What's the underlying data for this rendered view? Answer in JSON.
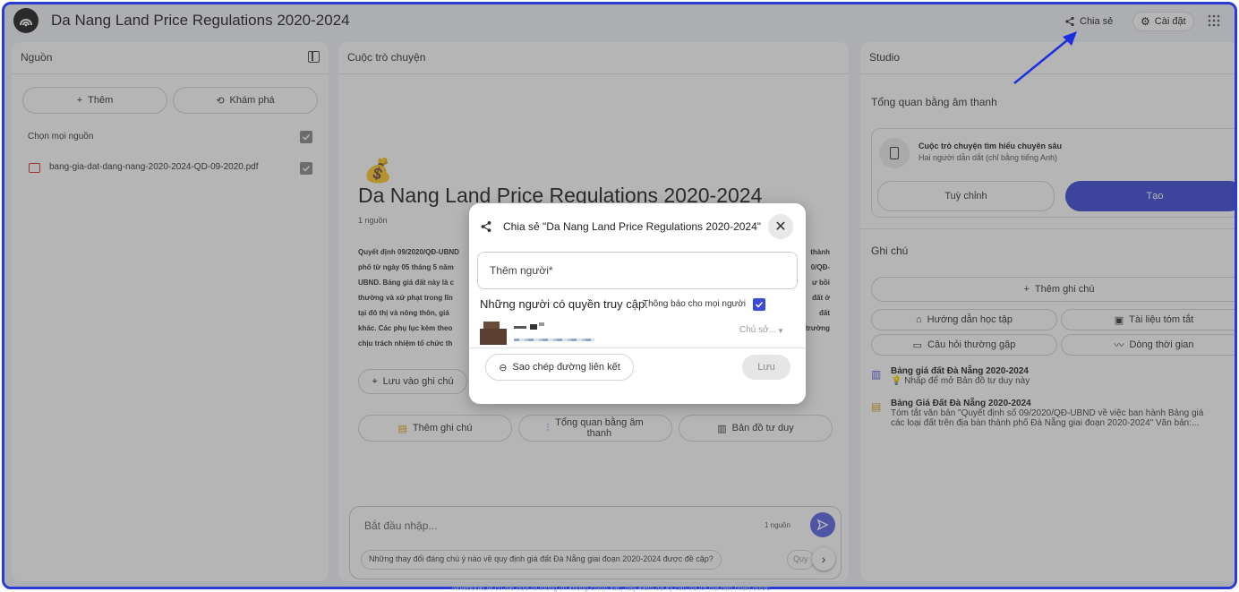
{
  "app": {
    "title": "Da Nang Land Price Regulations 2020-2024"
  },
  "topbar": {
    "share_label": "Chia sẻ",
    "settings_label": "Cài đặt"
  },
  "sources": {
    "header": "Nguồn",
    "add_label": "Thêm",
    "explore_label": "Khám phá",
    "select_all_label": "Chọn mọi nguồn",
    "files": [
      "bang-gia-dat-dang-nang-2020-2024-QD-09-2020.pdf"
    ]
  },
  "chat": {
    "header": "Cuộc trò chuyện",
    "emoji": "💰",
    "notebook_title": "Da Nang Land Price Regulations 2020-2024",
    "source_count": "1 nguồn",
    "summary_lines": [
      "Quyết định 09/2020/QĐ-UBND",
      "phố từ ngày 05 tháng 5 năm",
      "UBND. Bảng giá đất này là c",
      "thường và xử phạt trong lĩn",
      "tại đô thị và nông thôn, giá",
      "khác. Các phụ lục kèm theo",
      "chịu trách nhiệm tổ chức th"
    ],
    "summary_right": [
      "thành",
      "0/QĐ-",
      "ư bồi",
      "đất ở",
      "đất",
      "trường",
      ""
    ],
    "save_note_label": "Lưu vào ghi chú",
    "action_add_note": "Thêm ghi chú",
    "action_audio": "Tổng quan bằng âm thanh",
    "action_mindmap": "Bản đồ tư duy",
    "input_placeholder": "Bắt đầu nhập...",
    "input_source_count": "1 nguồn",
    "suggestion": "Những thay đổi đáng chú ý nào về quy định giá đất Đà Nẵng giai đoạn 2020-2024 được đề cập?",
    "suggestion_next": "Quy"
  },
  "studio": {
    "header": "Studio",
    "audio_overview_label": "Tổng quan bằng âm thanh",
    "deep_dive_title": "Cuộc trò chuyện tìm hiểu chuyên sâu",
    "deep_dive_sub": "Hai người dẫn dắt (chỉ bằng tiếng Anh)",
    "customize_label": "Tuỳ chỉnh",
    "generate_label": "Tạo",
    "notes_header": "Ghi chú",
    "add_note_label": "Thêm ghi chú",
    "study_guide_label": "Hướng dẫn học tập",
    "briefing_label": "Tài liệu tóm tắt",
    "faq_label": "Câu hỏi thường gặp",
    "timeline_label": "Dòng thời gian",
    "notes": [
      {
        "title": "Bảng giá đất Đà Nẵng 2020-2024",
        "body": "Nhấp để mở Bản đồ tư duy này"
      },
      {
        "title": "Bảng Giá Đất Đà Nẵng 2020-2024",
        "body": "Tóm tắt văn bản \"Quyết định số 09/2020/QĐ-UBND về việc ban hành Bảng giá",
        "body2": "các loại đất trên địa bàn thành phố Đà Nẵng giai đoạn 2020-2024\" Văn bản:..."
      }
    ]
  },
  "share_dialog": {
    "title": "Chia sẻ \"Da Nang Land Price Regulations 2020-2024\"",
    "add_people_placeholder": "Thêm người*",
    "access_label": "Những người có quyền truy cập.",
    "notify_label": "Thông báo cho mọi người",
    "owner_role": "Chủ sở...",
    "copy_link_label": "Sao chép đường liên kết",
    "save_label": "Lưu"
  },
  "footer_note": "NotebookLM có thể đưa ra thông tin không chính xác; hãy kiểm tra kỹ câu trả lời mà bạn nhận được.",
  "colors": {
    "accent": "#3c4ad6",
    "frame": "#2a3bd4",
    "arrow": "#1a2fe0"
  }
}
